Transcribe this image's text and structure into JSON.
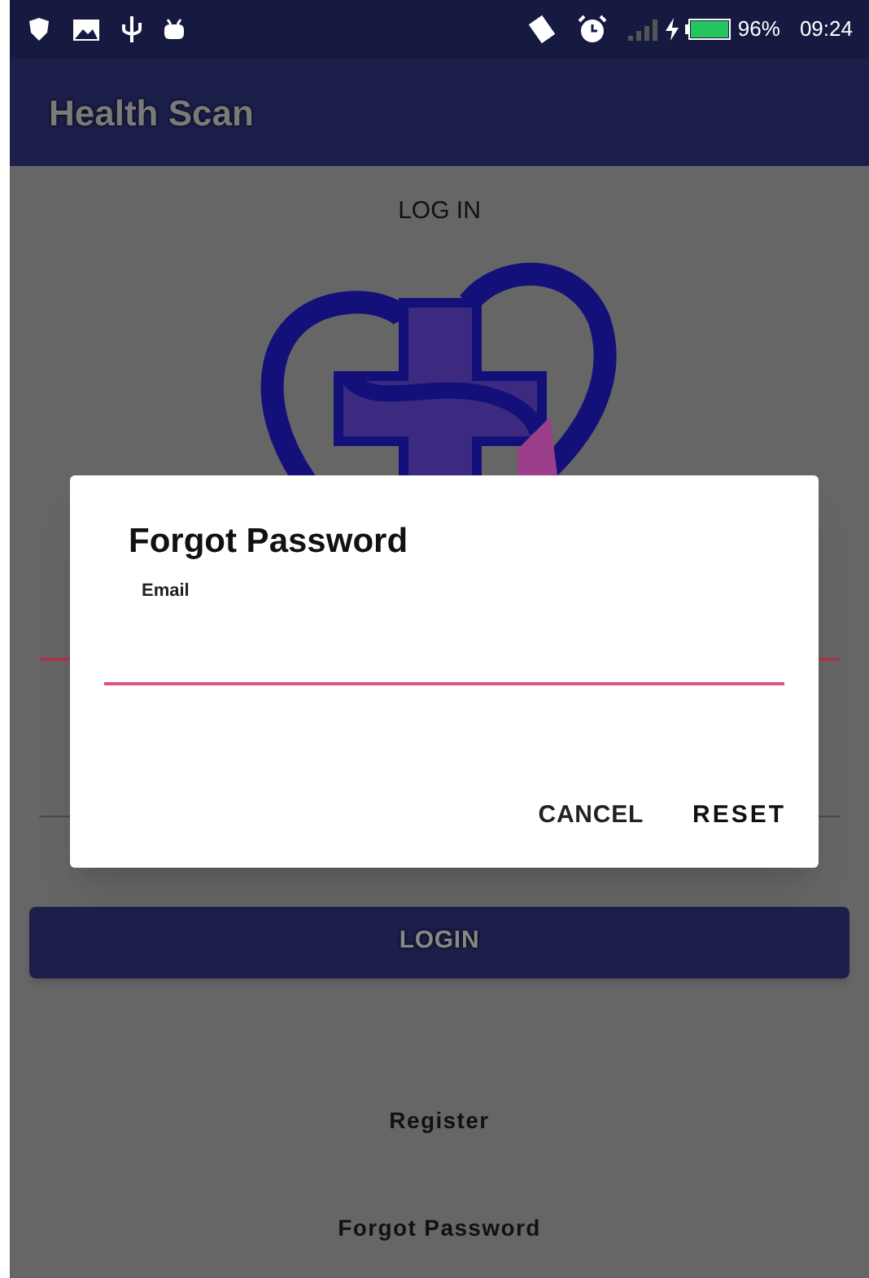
{
  "status_bar": {
    "battery": "96%",
    "time": "09:24"
  },
  "app_bar": {
    "title": "Health Scan"
  },
  "screen": {
    "heading": "LOG IN",
    "login_button": "LOGIN",
    "links": [
      "Register",
      "Forgot Password"
    ]
  },
  "dialog": {
    "title": "Forgot Password",
    "field": {
      "label": "Email",
      "focused": true
    },
    "buttons": [
      "CANCEL",
      "RESET"
    ]
  }
}
